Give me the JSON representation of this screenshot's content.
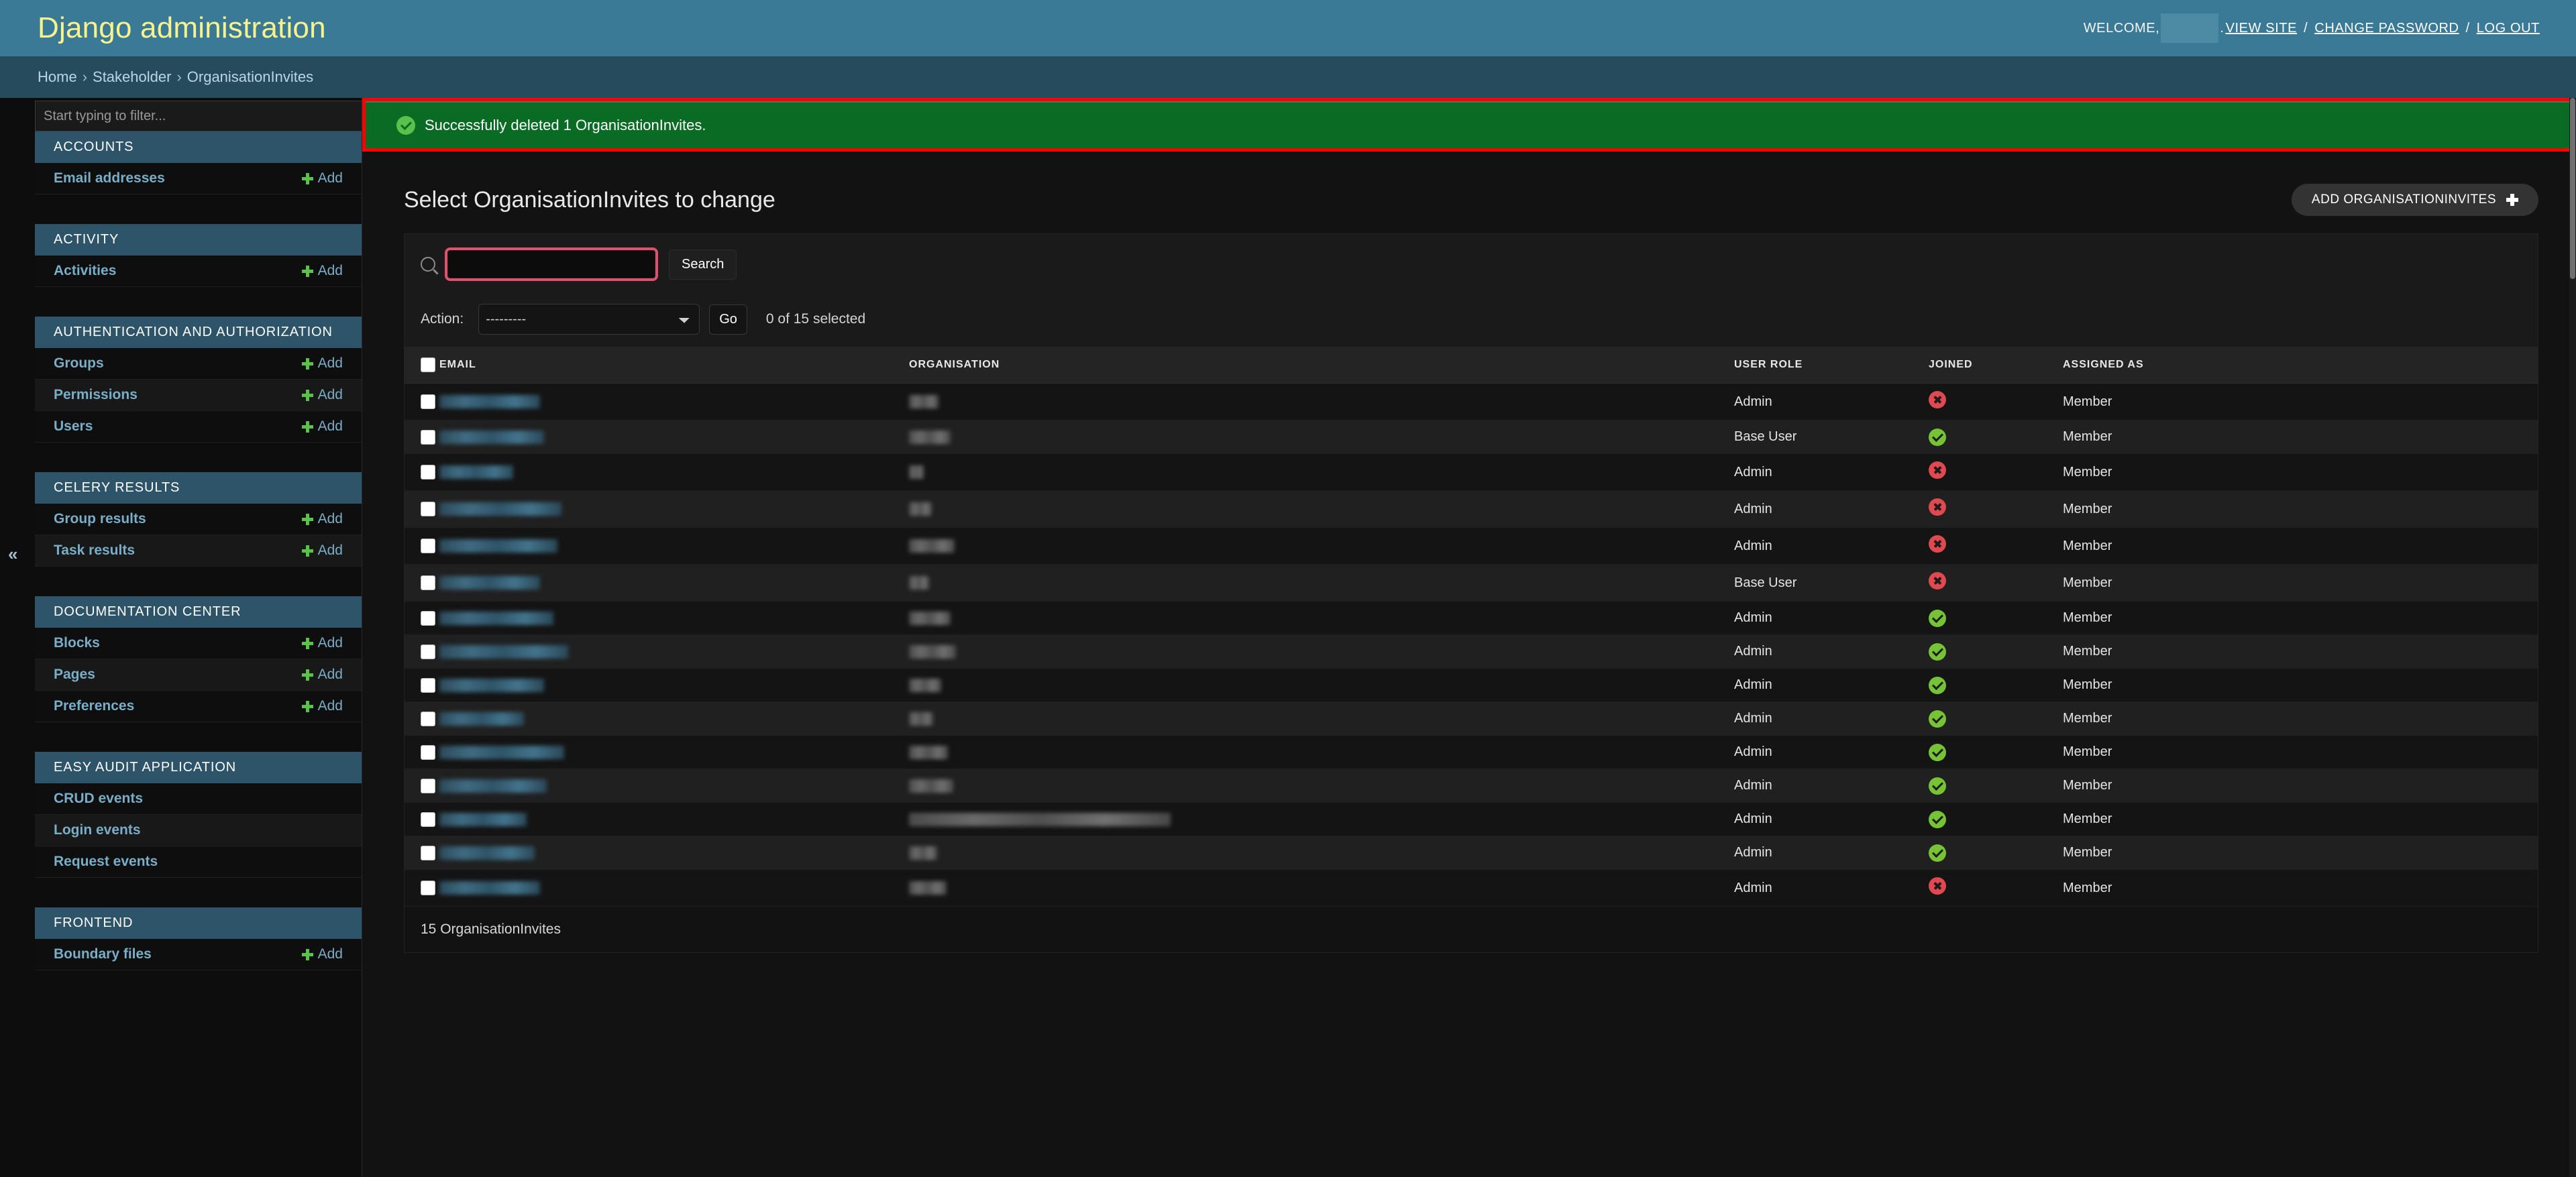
{
  "header": {
    "branding": "Django administration",
    "welcome_prefix": "WELCOME,",
    "welcome_suffix": ".",
    "view_site": "VIEW SITE",
    "change_password": "CHANGE PASSWORD",
    "log_out": "LOG OUT",
    "separator": "/"
  },
  "breadcrumbs": {
    "home": "Home",
    "app": "Stakeholder",
    "model": "OrganisationInvites",
    "separator": "›"
  },
  "sidebar": {
    "filter_placeholder": "Start typing to filter...",
    "toggle_icon": "«",
    "add_label": "Add",
    "modules": [
      {
        "caption": "ACCOUNTS",
        "models": [
          {
            "label": "Email addresses",
            "has_add": true
          }
        ]
      },
      {
        "caption": "ACTIVITY",
        "models": [
          {
            "label": "Activities",
            "has_add": true
          }
        ]
      },
      {
        "caption": "AUTHENTICATION AND AUTHORIZATION",
        "models": [
          {
            "label": "Groups",
            "has_add": true
          },
          {
            "label": "Permissions",
            "has_add": true
          },
          {
            "label": "Users",
            "has_add": true
          }
        ]
      },
      {
        "caption": "CELERY RESULTS",
        "models": [
          {
            "label": "Group results",
            "has_add": true
          },
          {
            "label": "Task results",
            "has_add": true
          }
        ]
      },
      {
        "caption": "DOCUMENTATION CENTER",
        "models": [
          {
            "label": "Blocks",
            "has_add": true
          },
          {
            "label": "Pages",
            "has_add": true
          },
          {
            "label": "Preferences",
            "has_add": true
          }
        ]
      },
      {
        "caption": "EASY AUDIT APPLICATION",
        "models": [
          {
            "label": "CRUD events",
            "has_add": false
          },
          {
            "label": "Login events",
            "has_add": false
          },
          {
            "label": "Request events",
            "has_add": false
          }
        ]
      },
      {
        "caption": "FRONTEND",
        "models": [
          {
            "label": "Boundary files",
            "has_add": true
          }
        ]
      }
    ]
  },
  "messages": {
    "success_text": "Successfully deleted 1 OrganisationInvites.",
    "success_icon": "check-circle-icon",
    "highlight_color": "#ff0000",
    "background_color": "#0a6b25"
  },
  "main": {
    "title": "Select OrganisationInvites to change",
    "add_button_label": "ADD ORGANISATIONINVITES",
    "search": {
      "value": "",
      "placeholder": "",
      "submit_label": "Search",
      "icon": "search-icon",
      "focus_ring_color": "#e0516e"
    },
    "actions": {
      "label": "Action:",
      "selected_option": "---------",
      "options": [
        "---------"
      ],
      "go_label": "Go",
      "counter": "0 of 15 selected"
    },
    "result_count": "15 OrganisationInvites"
  },
  "table": {
    "columns": [
      "",
      "EMAIL",
      "ORGANISATION",
      "USER ROLE",
      "JOINED",
      "ASSIGNED AS"
    ],
    "rows": [
      {
        "email_redacted": true,
        "email_width": 150,
        "org_redacted": true,
        "org_width": 44,
        "user_role": "Admin",
        "joined": false,
        "assigned_as": "Member"
      },
      {
        "email_redacted": true,
        "email_width": 156,
        "org_redacted": true,
        "org_width": 62,
        "user_role": "Base User",
        "joined": true,
        "assigned_as": "Member"
      },
      {
        "email_redacted": true,
        "email_width": 110,
        "org_redacted": true,
        "org_width": 22,
        "user_role": "Admin",
        "joined": false,
        "assigned_as": "Member"
      },
      {
        "email_redacted": true,
        "email_width": 182,
        "org_redacted": true,
        "org_width": 34,
        "user_role": "Admin",
        "joined": false,
        "assigned_as": "Member"
      },
      {
        "email_redacted": true,
        "email_width": 176,
        "org_redacted": true,
        "org_width": 68,
        "user_role": "Admin",
        "joined": false,
        "assigned_as": "Member"
      },
      {
        "email_redacted": true,
        "email_width": 150,
        "org_redacted": true,
        "org_width": 30,
        "user_role": "Base User",
        "joined": false,
        "assigned_as": "Member"
      },
      {
        "email_redacted": true,
        "email_width": 170,
        "org_redacted": true,
        "org_width": 62,
        "user_role": "Admin",
        "joined": true,
        "assigned_as": "Member"
      },
      {
        "email_redacted": true,
        "email_width": 192,
        "org_redacted": true,
        "org_width": 70,
        "user_role": "Admin",
        "joined": true,
        "assigned_as": "Member"
      },
      {
        "email_redacted": true,
        "email_width": 156,
        "org_redacted": true,
        "org_width": 48,
        "user_role": "Admin",
        "joined": true,
        "assigned_as": "Member"
      },
      {
        "email_redacted": true,
        "email_width": 126,
        "org_redacted": true,
        "org_width": 36,
        "user_role": "Admin",
        "joined": true,
        "assigned_as": "Member"
      },
      {
        "email_redacted": true,
        "email_width": 186,
        "org_redacted": true,
        "org_width": 58,
        "user_role": "Admin",
        "joined": true,
        "assigned_as": "Member"
      },
      {
        "email_redacted": true,
        "email_width": 160,
        "org_redacted": true,
        "org_width": 66,
        "user_role": "Admin",
        "joined": true,
        "assigned_as": "Member"
      },
      {
        "email_redacted": true,
        "email_width": 130,
        "org_redacted": true,
        "org_width": 390,
        "user_role": "Admin",
        "joined": true,
        "assigned_as": "Member"
      },
      {
        "email_redacted": true,
        "email_width": 142,
        "org_redacted": true,
        "org_width": 42,
        "user_role": "Admin",
        "joined": true,
        "assigned_as": "Member"
      },
      {
        "email_redacted": true,
        "email_width": 150,
        "org_redacted": true,
        "org_width": 56,
        "user_role": "Admin",
        "joined": false,
        "assigned_as": "Member"
      }
    ]
  }
}
